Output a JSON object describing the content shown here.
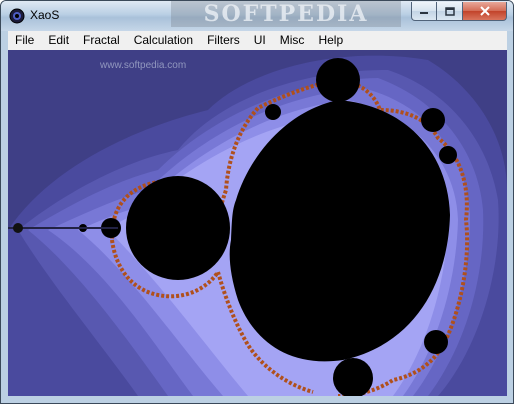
{
  "window": {
    "title": "XaoS",
    "title_watermark": "SOFTPEDIA",
    "buttons": {
      "minimize": "minimize-icon",
      "maximize": "maximize-icon",
      "close": "close-icon"
    }
  },
  "menu": {
    "items": [
      "File",
      "Edit",
      "Fractal",
      "Calculation",
      "Filters",
      "UI",
      "Misc",
      "Help"
    ]
  },
  "canvas": {
    "watermark": "www.softpedia.com",
    "fractal": "mandelbrot-set",
    "colors": {
      "background": "#3f3f86",
      "band1": "#5858b0",
      "band2": "#7272d0",
      "band3": "#8c8ce6",
      "band4": "#a8a8f4",
      "edge": "#b0501c",
      "set": "#000000"
    }
  }
}
